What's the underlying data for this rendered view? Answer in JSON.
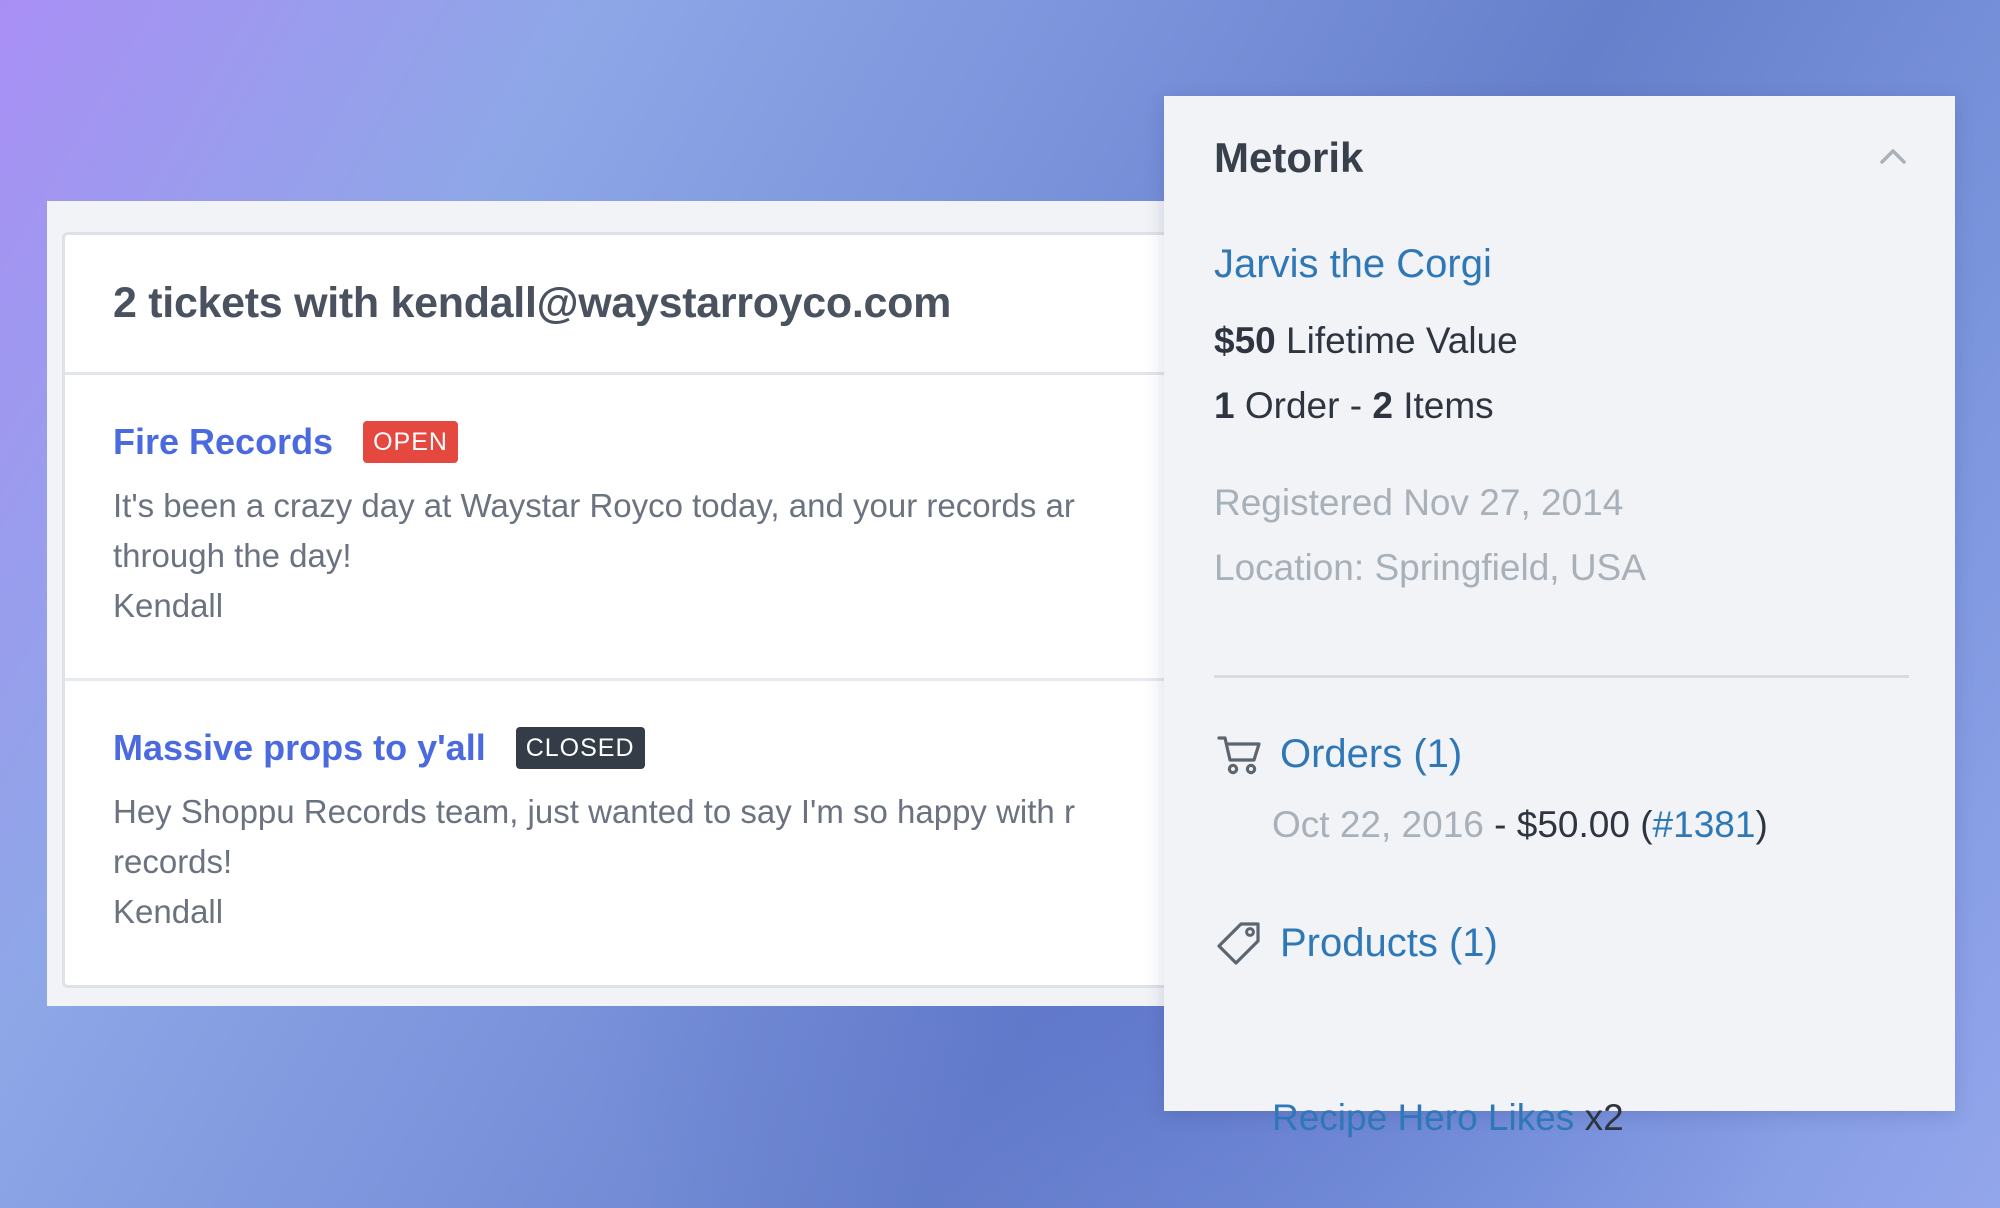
{
  "tickets_panel": {
    "header_count": "2",
    "header_text": "tickets with",
    "header_email": "kendall@waystarroyco.com",
    "tickets": [
      {
        "title": "Fire Records",
        "status": "OPEN",
        "body_line1": "It's been a crazy day at Waystar Royco today, and your records ar",
        "body_line2": "through the day!",
        "signature": "Kendall"
      },
      {
        "title": "Massive props to y'all",
        "status": "CLOSED",
        "body_line1": "Hey Shoppu Records team, just wanted to say I'm so happy with r",
        "body_line2": "records!",
        "signature": "Kendall"
      }
    ]
  },
  "metorik": {
    "title": "Metorik",
    "customer_name": "Jarvis the Corgi",
    "lifetime_value_amount": "$50",
    "lifetime_value_label": "Lifetime Value",
    "order_count": "1",
    "order_label": "Order -",
    "item_count": "2",
    "item_label": "Items",
    "registered": "Registered Nov 27, 2014",
    "location": "Location: Springfield, USA",
    "orders_heading": "Orders (1)",
    "orders": [
      {
        "date": "Oct 22, 2016",
        "separator": " - ",
        "amount": "$50.00",
        "number": "#1381"
      }
    ],
    "products_heading": "Products (1)",
    "products": [
      {
        "name": "Recipe Hero Likes",
        "quantity": "x2"
      }
    ]
  },
  "colors": {
    "link_blue": "#2f78b7",
    "ticket_title_blue": "#4c6ae0",
    "open_badge": "#e5483f",
    "closed_badge": "#333c47"
  },
  "icons": {
    "collapse": "chevron-up-icon",
    "orders": "cart-icon",
    "products": "tag-icon"
  }
}
